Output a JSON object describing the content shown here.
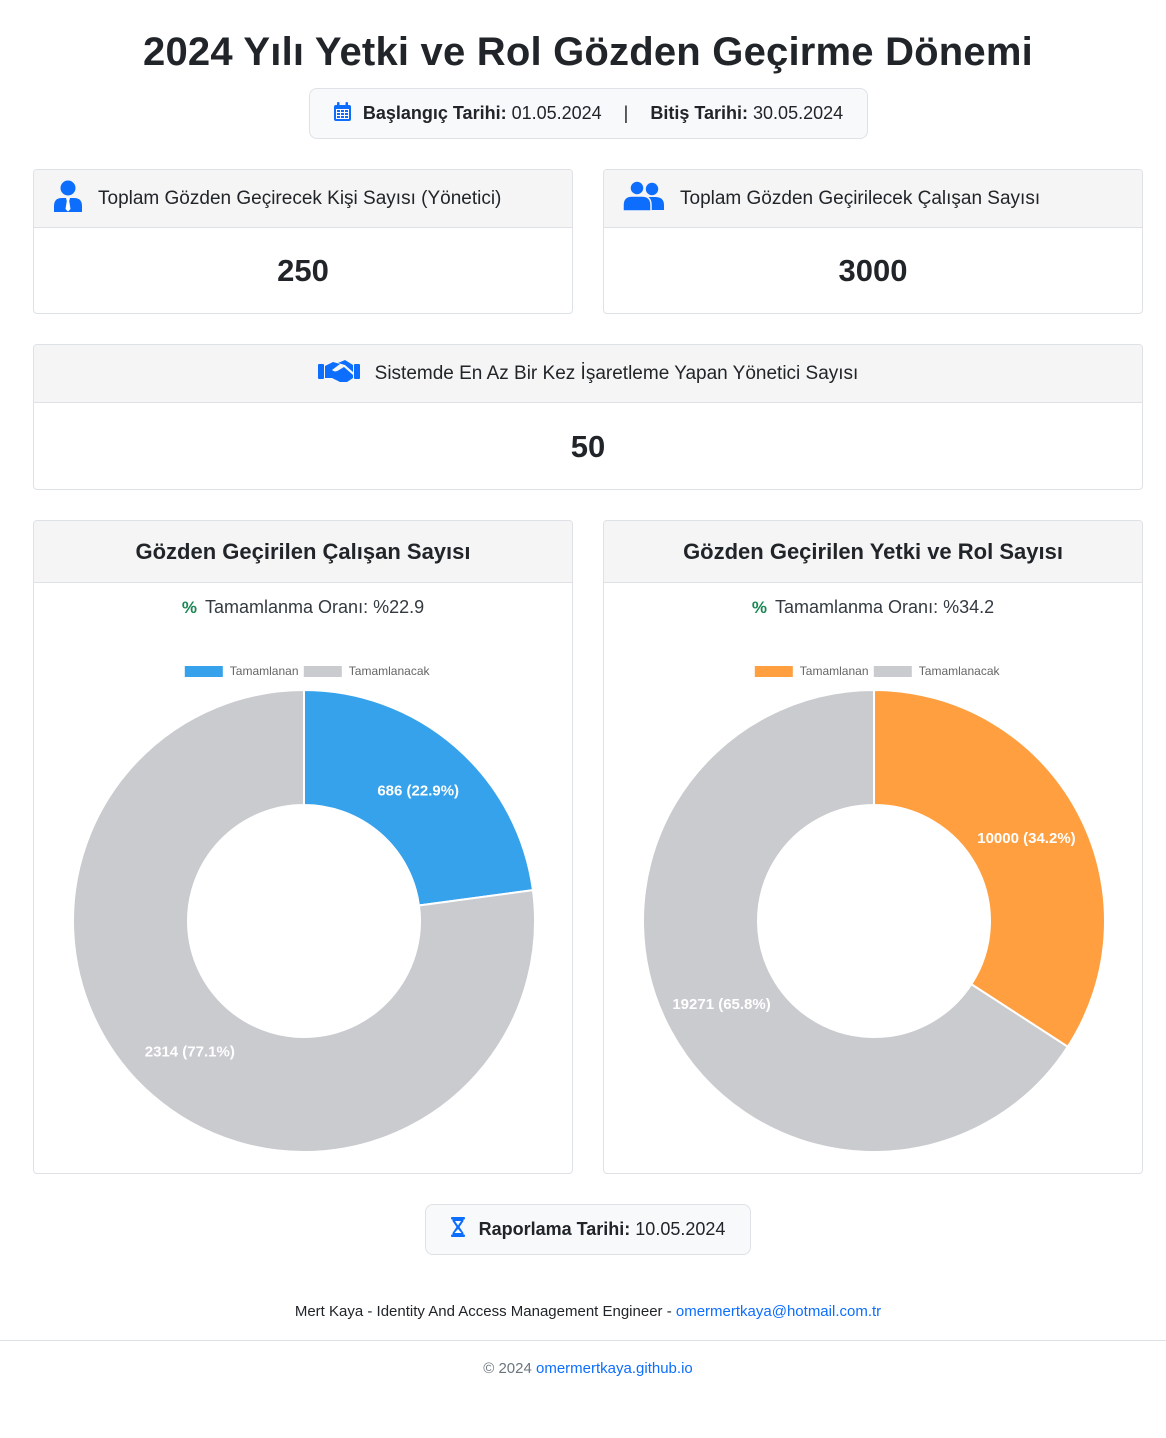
{
  "header": {
    "title": "2024 Yılı Yetki ve Rol Gözden Geçirme Dönemi",
    "start_label": "Başlangıç Tarihi:",
    "start_value": "01.05.2024",
    "separator": "|",
    "end_label": "Bitiş Tarihi:",
    "end_value": "30.05.2024"
  },
  "stats": {
    "managers": {
      "title": "Toplam Gözden Geçirecek Kişi Sayısı (Yönetici)",
      "value": "250",
      "icon": "user-tie-icon"
    },
    "employees": {
      "title": "Toplam Gözden Geçirilecek Çalışan Sayısı",
      "value": "3000",
      "icon": "users-icon"
    },
    "marked": {
      "title": "Sistemde En Az Bir Kez İşaretleme Yapan Yönetici Sayısı",
      "value": "50",
      "icon": "handshake-icon"
    }
  },
  "colors": {
    "accent": "#0d6efd",
    "done_blue": "#36a2eb",
    "done_orange": "#ff9f40",
    "remaining": "#c9cbcf",
    "rate_icon": "#198754"
  },
  "chart_data": [
    {
      "type": "pie",
      "title": "Gözden Geçirilen Çalışan Sayısı",
      "rate_text": "Tamamlanma Oranı: %22.9",
      "categories": [
        "Tamamlanan",
        "Tamamlanacak"
      ],
      "values": [
        686,
        2314
      ],
      "labels": [
        "686 (22.9%)",
        "2314 (77.1%)"
      ],
      "colors": [
        "#36a2eb",
        "#c9cbcf"
      ],
      "legend": "top"
    },
    {
      "type": "pie",
      "title": "Gözden Geçirilen Yetki ve Rol Sayısı",
      "rate_text": "Tamamlanma Oranı: %34.2",
      "categories": [
        "Tamamlanan",
        "Tamamlanacak"
      ],
      "values": [
        10000,
        19271
      ],
      "labels": [
        "10000 (34.2%)",
        "19271 (65.8%)"
      ],
      "colors": [
        "#ff9f40",
        "#c9cbcf"
      ],
      "legend": "top"
    }
  ],
  "report": {
    "label": "Raporlama Tarihi:",
    "value": "10.05.2024",
    "icon": "hourglass-icon"
  },
  "footer": {
    "author": "Mert Kaya - Identity And Access Management Engineer - ",
    "email": "omermertkaya@hotmail.com.tr",
    "copyright": "© 2024 ",
    "site": "omermertkaya.github.io"
  }
}
